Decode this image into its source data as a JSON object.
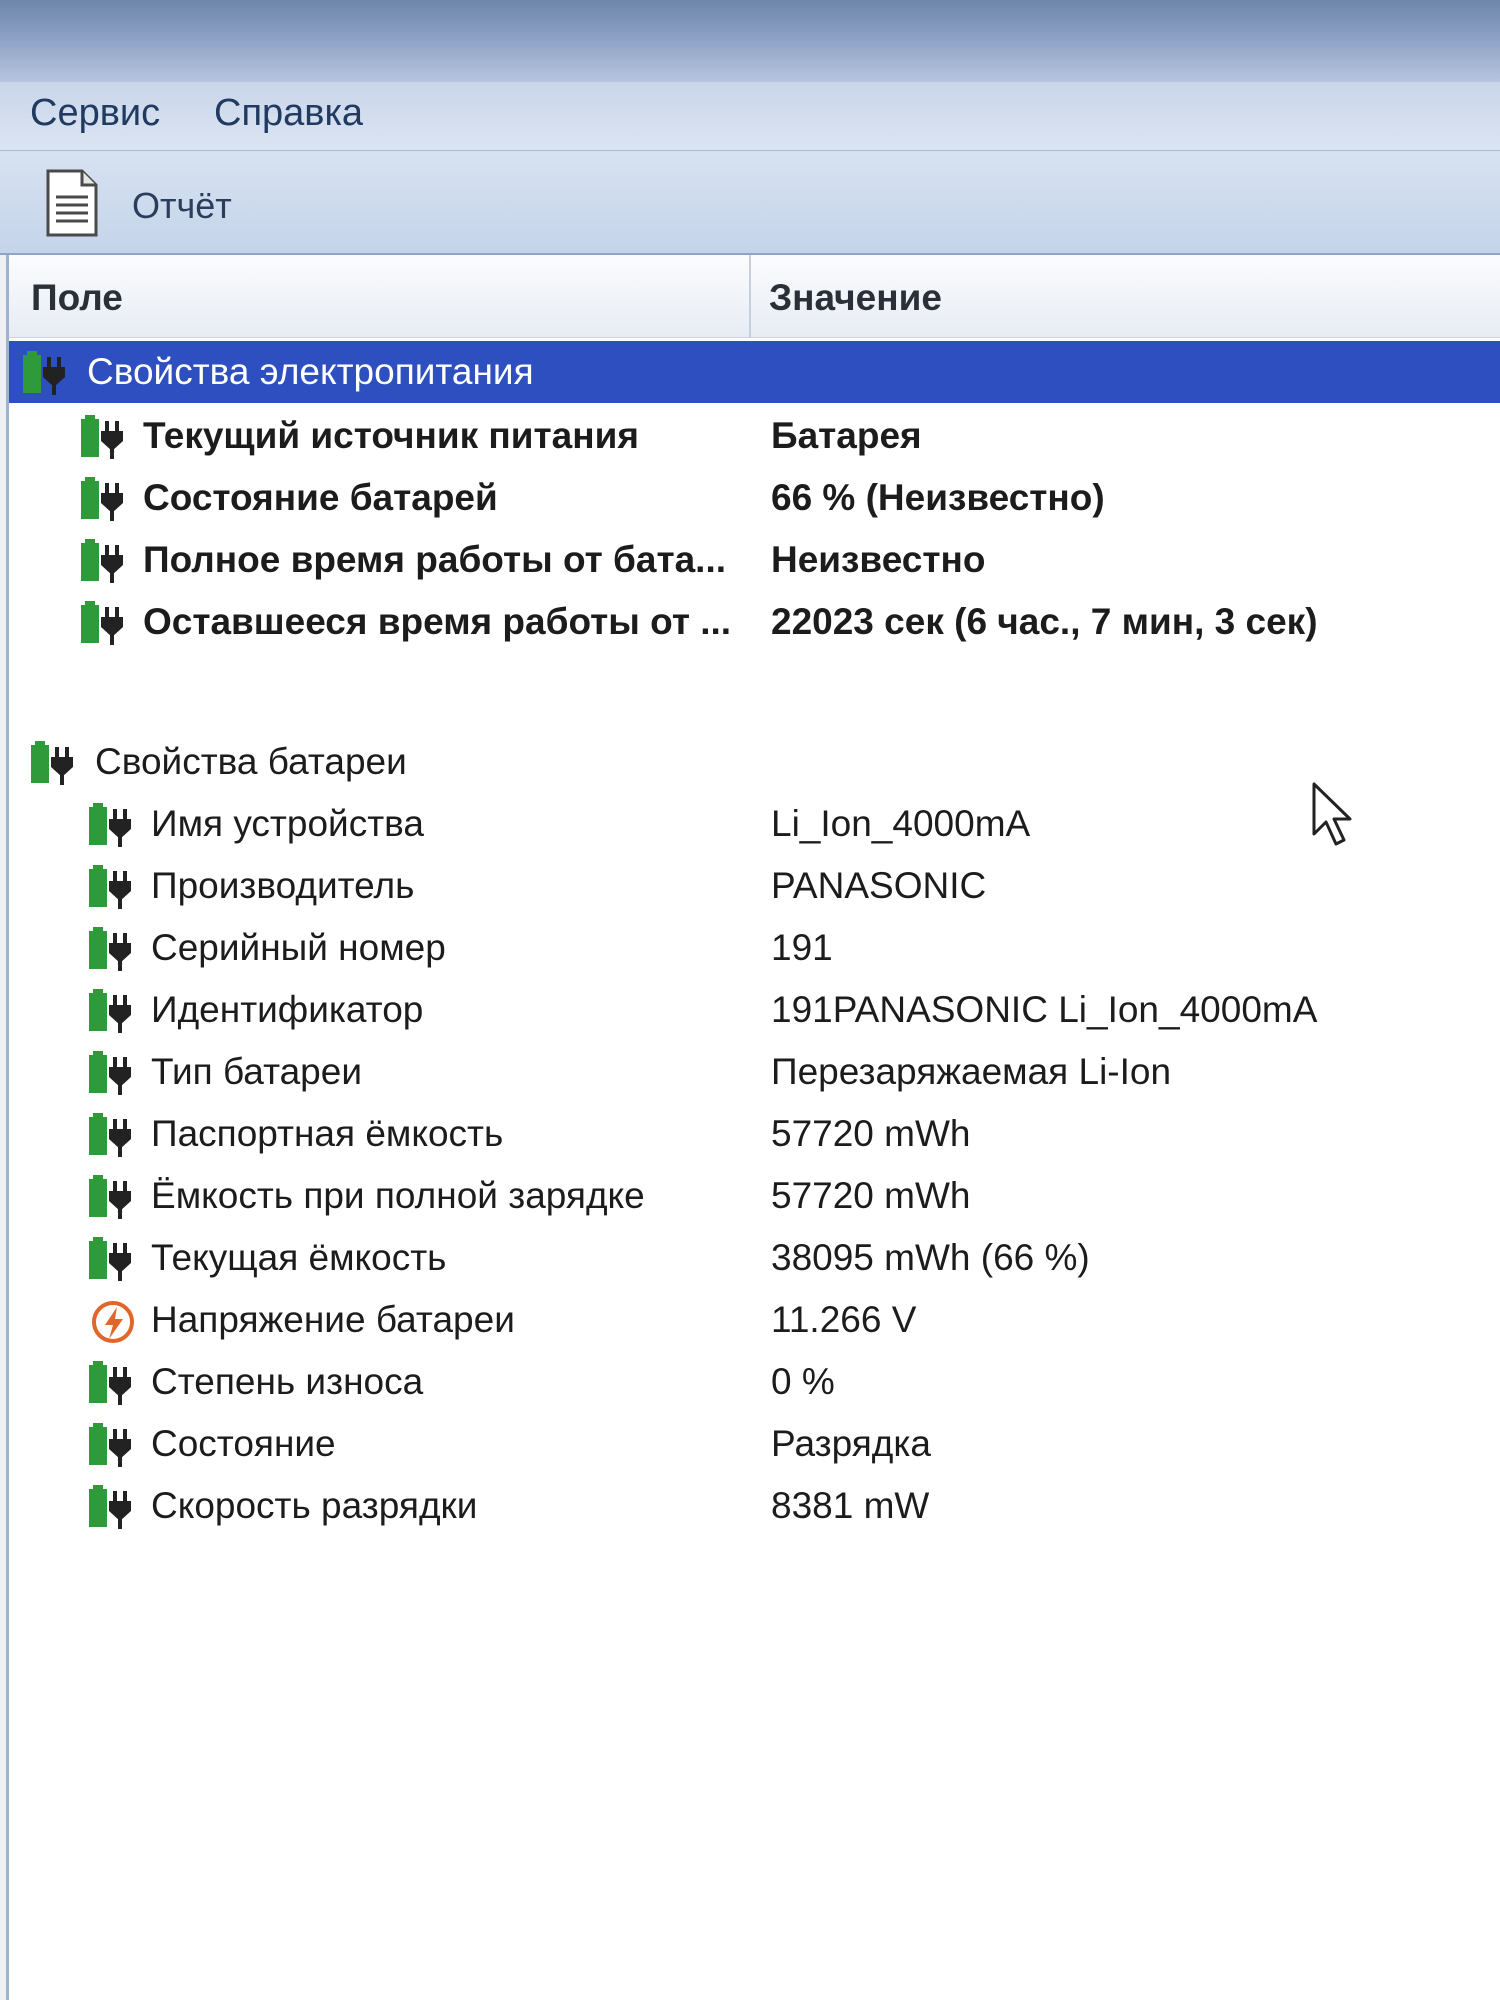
{
  "menu": {
    "service": "Сервис",
    "help": "Справка"
  },
  "toolbar": {
    "report_label": "Отчёт",
    "report_icon": "document-icon"
  },
  "columns": {
    "field": "Поле",
    "value": "Значение"
  },
  "groups": [
    {
      "label": "Свойства электропитания",
      "rows": [
        {
          "field": "Текущий источник питания",
          "value": "Батарея"
        },
        {
          "field": "Состояние батарей",
          "value": "66 % (Неизвестно)"
        },
        {
          "field": "Полное время работы от бата...",
          "value": "Неизвестно"
        },
        {
          "field": "Оставшееся время работы от ...",
          "value": "22023 сек (6 час., 7 мин, 3 сек)"
        }
      ]
    },
    {
      "label": "Свойства батареи",
      "rows": [
        {
          "field": "Имя устройства",
          "value": "Li_Ion_4000mA"
        },
        {
          "field": "Производитель",
          "value": "PANASONIC"
        },
        {
          "field": "Серийный номер",
          "value": "191"
        },
        {
          "field": "Идентификатор",
          "value": "191PANASONIC Li_Ion_4000mA"
        },
        {
          "field": "Тип батареи",
          "value": "Перезаряжаемая Li-Ion"
        },
        {
          "field": "Паспортная ёмкость",
          "value": "57720 mWh"
        },
        {
          "field": "Ёмкость при полной зарядке",
          "value": "57720 mWh"
        },
        {
          "field": "Текущая ёмкость",
          "value": "38095 mWh  (66 %)"
        },
        {
          "field": "Напряжение батареи",
          "value": "11.266 V"
        },
        {
          "field": "Степень износа",
          "value": "0 %"
        },
        {
          "field": "Состояние",
          "value": "Разрядка"
        },
        {
          "field": "Скорость разрядки",
          "value": "8381 mW"
        }
      ]
    }
  ],
  "icons": {
    "battery": "battery-plug-icon",
    "voltage": "voltage-icon"
  },
  "colors": {
    "selection": "#2d4fbf",
    "battery_green": "#2f9a3a",
    "voltage_orange": "#e0662a"
  }
}
